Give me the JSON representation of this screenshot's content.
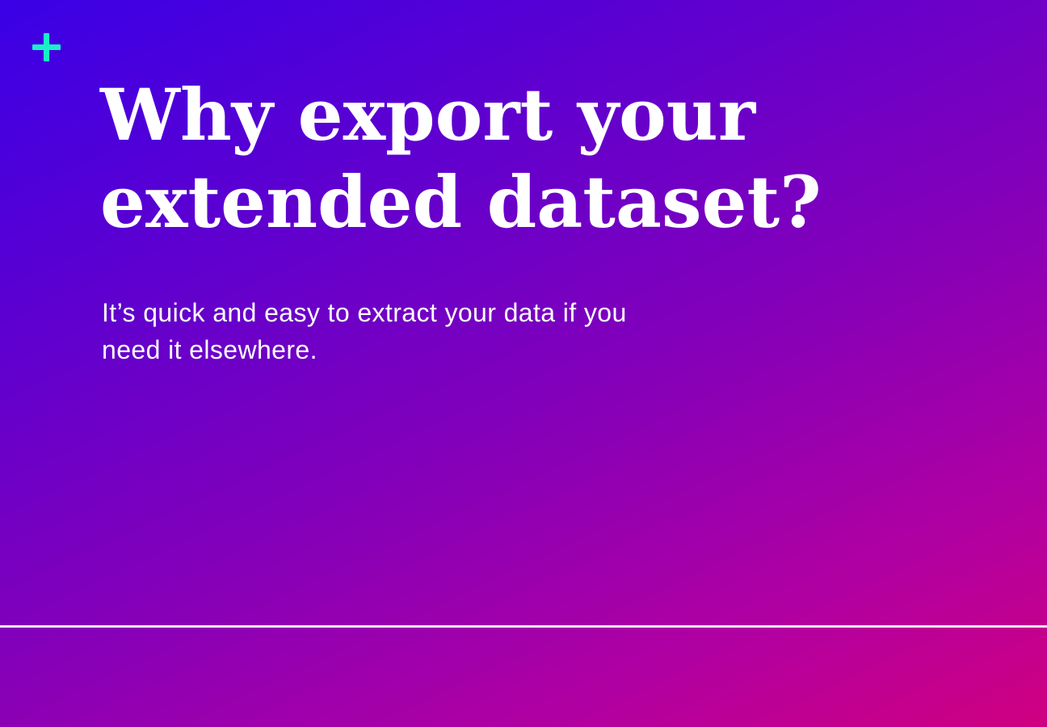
{
  "hero": {
    "headline_line1": "Why export your",
    "headline_line2": "extended dataset?",
    "subtext_line1": "It’s quick and easy to extract your data if you",
    "subtext_line2": "need it elsewhere."
  },
  "icons": {
    "corner": "plus-icon"
  },
  "colors": {
    "gradient_start": "#3a00e6",
    "gradient_end": "#d00080",
    "accent": "#19f0c8",
    "text": "#ffffff"
  }
}
